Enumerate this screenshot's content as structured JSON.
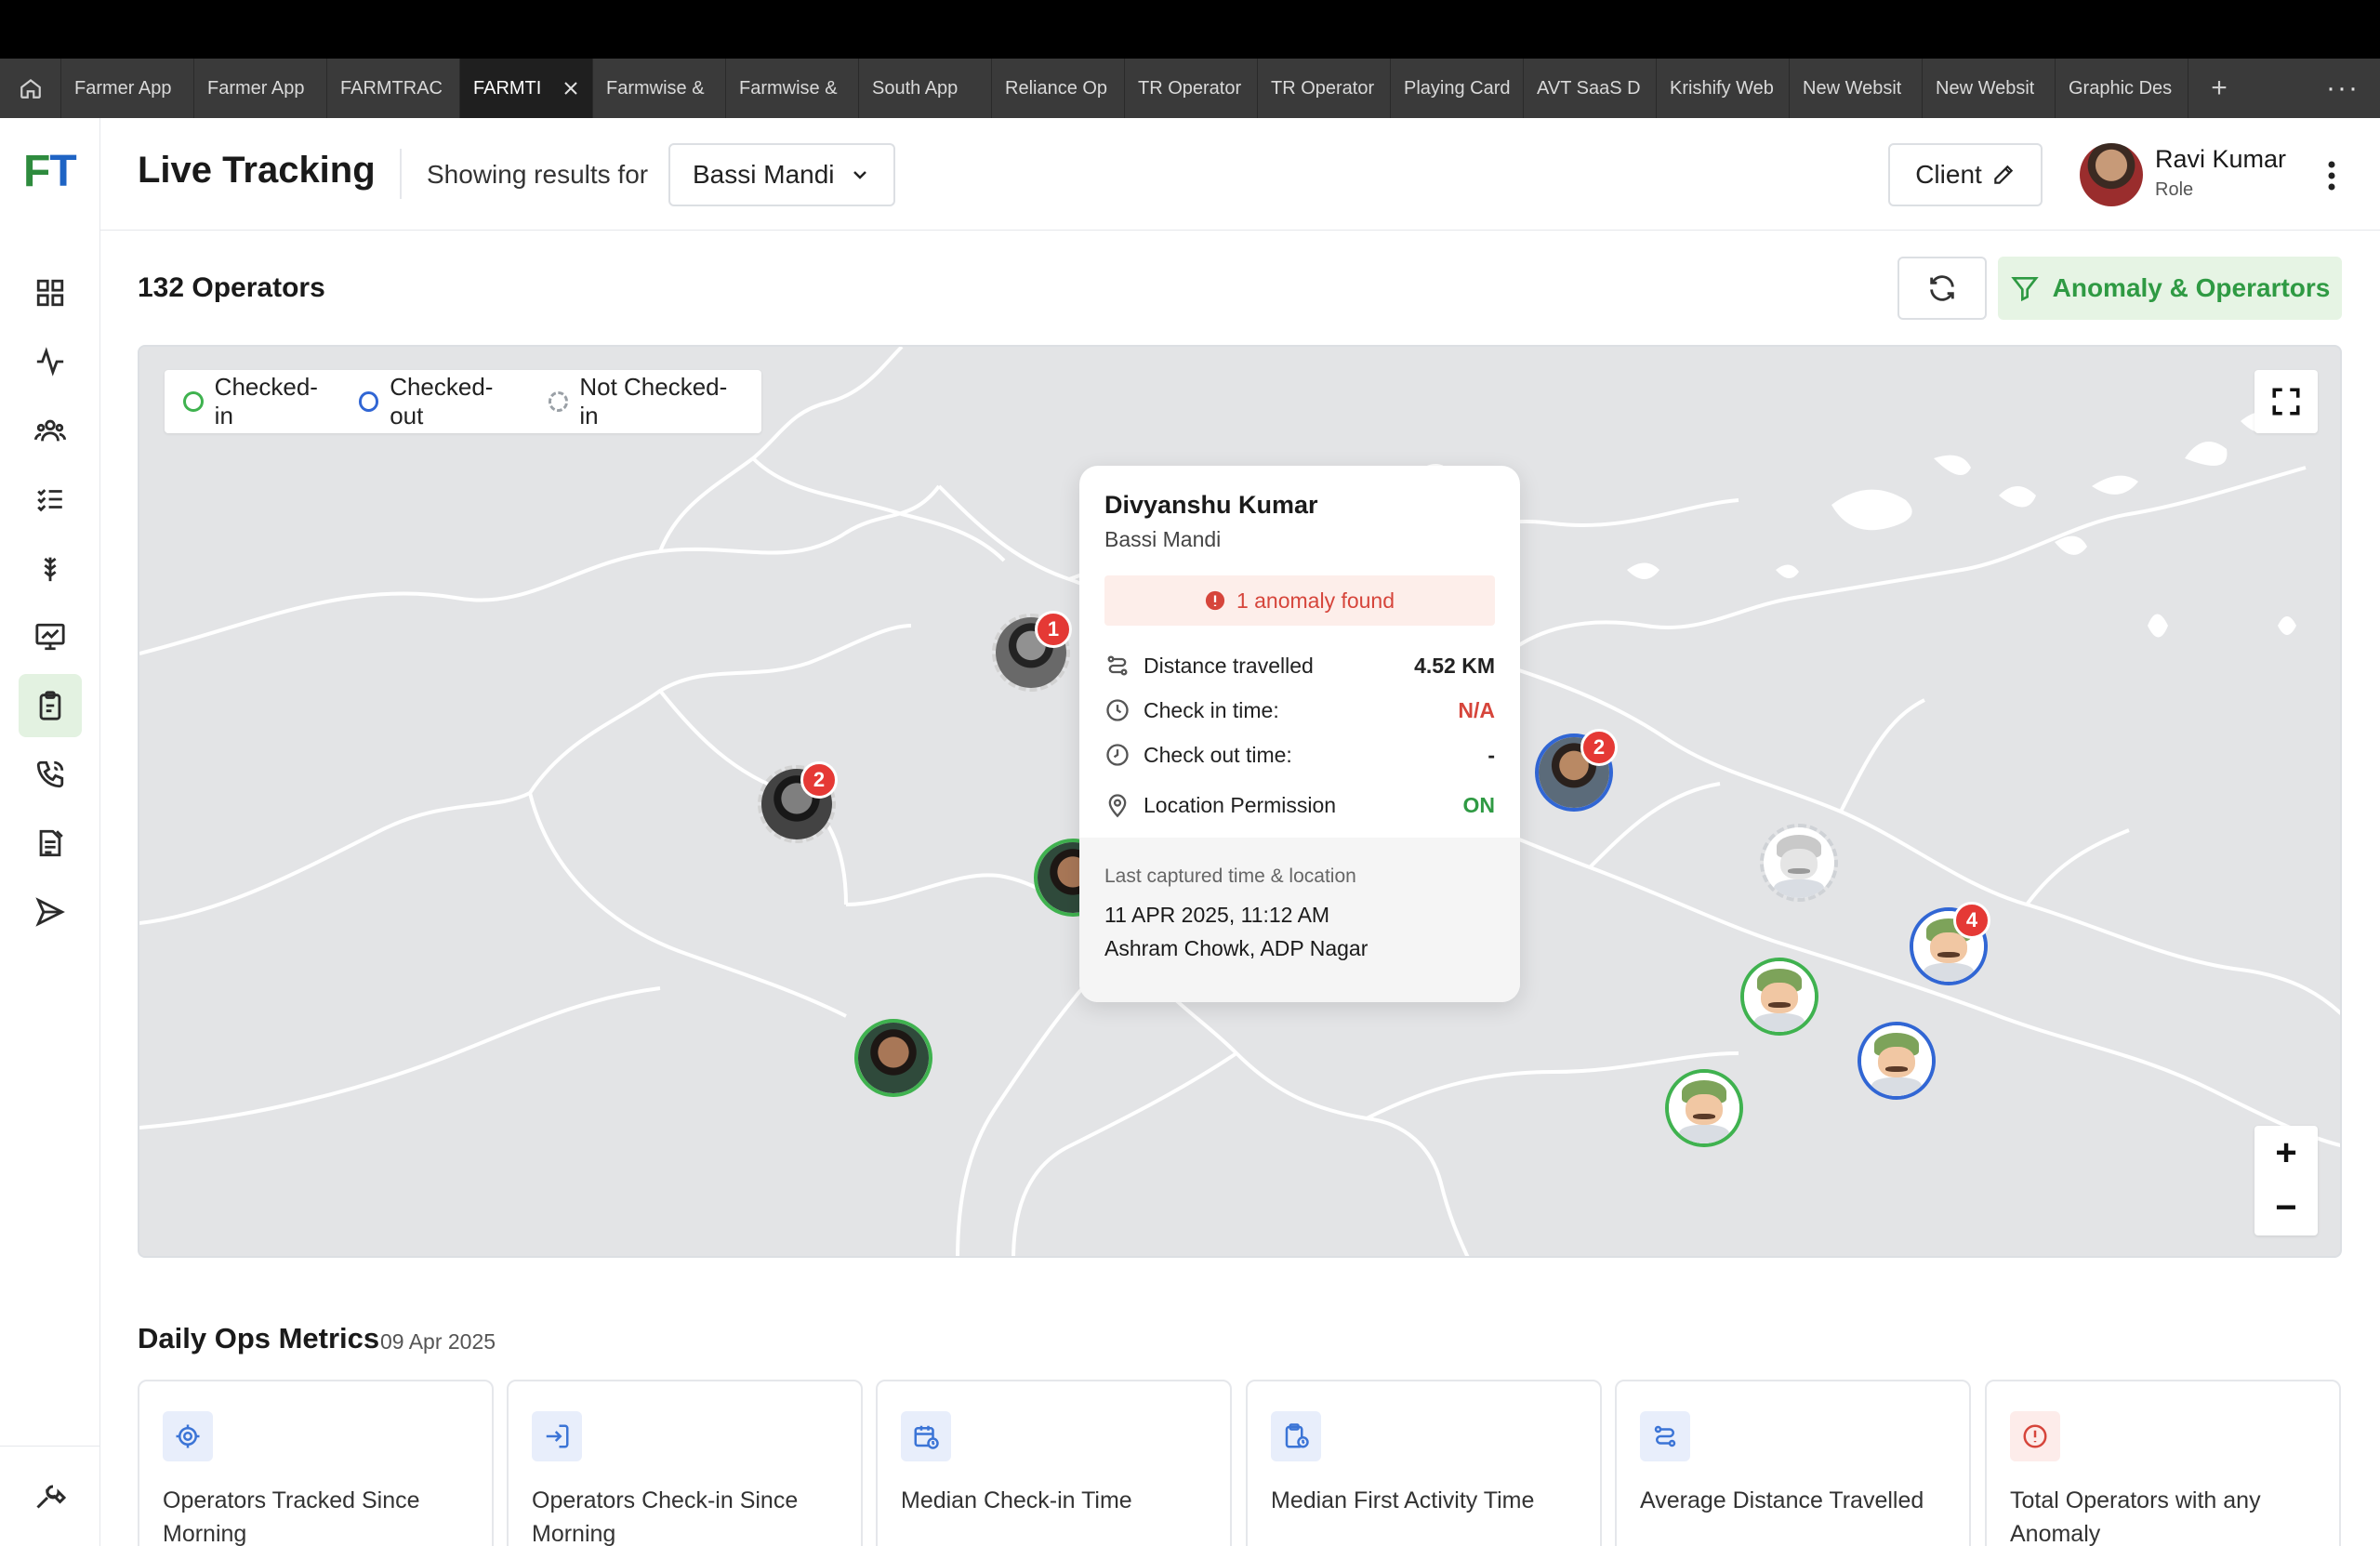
{
  "browser": {
    "tabs": [
      {
        "label": "Farmer App",
        "active": false
      },
      {
        "label": "Farmer App",
        "active": false
      },
      {
        "label": "FARMTRAC",
        "active": false
      },
      {
        "label": "FARMTI",
        "active": true
      },
      {
        "label": "Farmwise &",
        "active": false
      },
      {
        "label": "Farmwise &",
        "active": false
      },
      {
        "label": "South App",
        "active": false
      },
      {
        "label": "Reliance Op",
        "active": false
      },
      {
        "label": "TR Operator",
        "active": false
      },
      {
        "label": "TR Operator",
        "active": false
      },
      {
        "label": "Playing Card",
        "active": false
      },
      {
        "label": "AVT SaaS D",
        "active": false
      },
      {
        "label": "Krishify Web",
        "active": false
      },
      {
        "label": "New Websit",
        "active": false
      },
      {
        "label": "New Websit",
        "active": false
      },
      {
        "label": "Graphic Des",
        "active": false
      }
    ],
    "add_tab": "+",
    "more": "···"
  },
  "sidebar": {
    "logo_f": "F",
    "logo_t": "T",
    "items": [
      {
        "name": "dashboard-grid-icon",
        "active": false
      },
      {
        "name": "activity-pulse-icon",
        "active": false
      },
      {
        "name": "users-group-icon",
        "active": false
      },
      {
        "name": "checklist-icon",
        "active": false
      },
      {
        "name": "crop-plant-icon",
        "active": false
      },
      {
        "name": "monitor-chart-icon",
        "active": false
      },
      {
        "name": "clipboard-icon",
        "active": true
      },
      {
        "name": "phone-call-icon",
        "active": false
      },
      {
        "name": "report-form-icon",
        "active": false
      },
      {
        "name": "send-icon",
        "active": false
      }
    ],
    "bottom_item": "tools-icon"
  },
  "header": {
    "title": "Live Tracking",
    "showing_label": "Showing results for",
    "location": "Bassi Mandi",
    "client_label": "Client",
    "user_name": "Ravi Kumar",
    "user_role": "Role"
  },
  "toolbar": {
    "operators_count": "132 Operators",
    "anomaly_button": "Anomaly & Operartors"
  },
  "map": {
    "legend": {
      "checked_in": "Checked-in",
      "checked_out": "Checked-out",
      "not_checked_in": "Not Checked-in"
    },
    "zoom_in": "+",
    "zoom_out": "−",
    "markers": [
      {
        "status": "not-checked",
        "style": "photo",
        "badge": "1"
      },
      {
        "status": "not-checked",
        "style": "photo",
        "badge": "2"
      },
      {
        "status": "checked-in",
        "style": "photo",
        "badge": ""
      },
      {
        "status": "checked-in",
        "style": "photo",
        "badge": ""
      },
      {
        "status": "checked-out",
        "style": "photo",
        "badge": "2"
      },
      {
        "status": "not-checked",
        "style": "cartoon",
        "badge": ""
      },
      {
        "status": "checked-out",
        "style": "cartoon",
        "badge": "4"
      },
      {
        "status": "checked-in",
        "style": "cartoon",
        "badge": ""
      },
      {
        "status": "checked-out",
        "style": "cartoon",
        "badge": ""
      },
      {
        "status": "checked-in",
        "style": "cartoon",
        "badge": ""
      }
    ],
    "popup": {
      "name": "Divyanshu Kumar",
      "location": "Bassi Mandi",
      "anomaly": "1 anomaly found",
      "rows": [
        {
          "label": "Distance travelled",
          "value": "4.52 KM"
        },
        {
          "label": "Check in time:",
          "value": "N/A"
        },
        {
          "label": "Check out time:",
          "value": "-"
        },
        {
          "label": "Location Permission",
          "value": "ON"
        }
      ],
      "last_captured_label": "Last captured time & location",
      "last_time": "11 APR 2025, 11:12 AM",
      "last_place": "Ashram Chowk, ADP Nagar"
    }
  },
  "metrics": {
    "title": "Daily Ops Metrics",
    "date": "09 Apr 2025",
    "cards": [
      {
        "label": "Operators Tracked Since Morning",
        "icon": "target-icon"
      },
      {
        "label": "Operators Check-in Since Morning",
        "icon": "check-in-icon"
      },
      {
        "label": "Median Check-in Time",
        "icon": "calendar-clock-icon"
      },
      {
        "label": "Median First Activity Time",
        "icon": "clipboard-clock-icon"
      },
      {
        "label": "Average Distance Travelled",
        "icon": "route-icon"
      },
      {
        "label": "Total Operators with any Anomaly",
        "icon": "alert-circle-icon"
      }
    ]
  },
  "colors": {
    "brand_green": "#2f9a43",
    "brand_blue": "#1f64c4",
    "checked_in": "#3fb24f",
    "checked_out": "#3166d4",
    "alert_red": "#e53935"
  }
}
